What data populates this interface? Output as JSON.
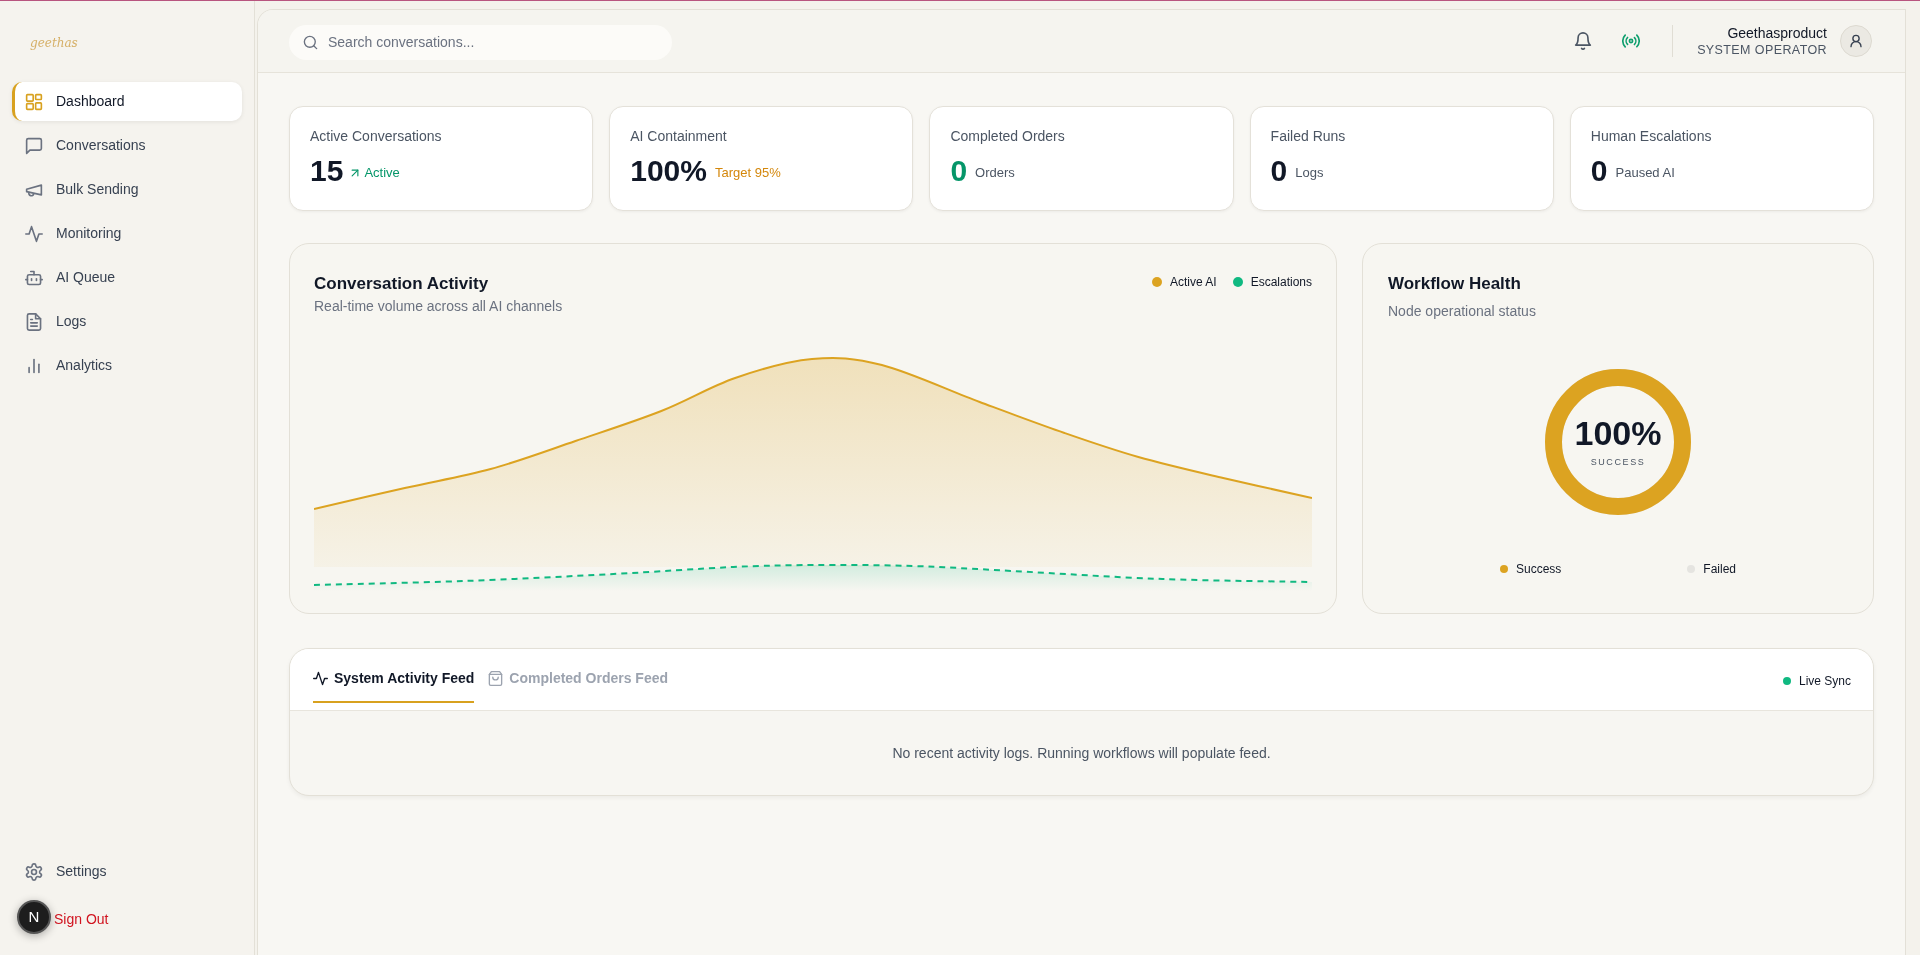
{
  "brand": "geethas",
  "sidebar": {
    "items": [
      {
        "label": "Dashboard",
        "selected": true
      },
      {
        "label": "Conversations",
        "selected": false
      },
      {
        "label": "Bulk Sending",
        "selected": false
      },
      {
        "label": "Monitoring",
        "selected": false
      },
      {
        "label": "AI Queue",
        "selected": false
      },
      {
        "label": "Logs",
        "selected": false
      },
      {
        "label": "Analytics",
        "selected": false
      }
    ],
    "footer": [
      {
        "label": "Settings",
        "kind": "settings"
      },
      {
        "label": "Sign Out",
        "kind": "signout"
      }
    ]
  },
  "dev_badge": "N",
  "header": {
    "search": {
      "placeholder": "Search conversations..."
    },
    "user": {
      "name": "Geethasproduct",
      "role": "SYSTEM OPERATOR"
    }
  },
  "stats": [
    {
      "label": "Active Conversations",
      "value": "15",
      "note": "Active",
      "kind": "trend",
      "highlight": false
    },
    {
      "label": "AI Containment",
      "value": "100%",
      "note": "Target 95%",
      "kind": "target",
      "highlight": false
    },
    {
      "label": "Completed Orders",
      "value": "0",
      "note": "Orders",
      "kind": "unit",
      "highlight": true
    },
    {
      "label": "Failed Runs",
      "value": "0",
      "note": "Logs",
      "kind": "unit",
      "highlight": false
    },
    {
      "label": "Human Escalations",
      "value": "0",
      "note": "Paused AI",
      "kind": "unit",
      "highlight": false
    }
  ],
  "activity_chart": {
    "title": "Conversation Activity",
    "subtitle": "Real-time volume across all AI channels",
    "legend": [
      {
        "label": "Active AI",
        "color": "#dca321"
      },
      {
        "label": "Escalations",
        "color": "#10b981"
      }
    ]
  },
  "health": {
    "title": "Workflow Health",
    "subtitle": "Node operational status",
    "level": 1,
    "value": "100%",
    "caption": "SUCCESS",
    "legend": [
      {
        "label": "Success",
        "color": "#dca321"
      },
      {
        "label": "Failed",
        "color": "#e5e4e0"
      }
    ]
  },
  "feed": {
    "tabs": [
      {
        "label": "System Activity Feed",
        "selected": true
      },
      {
        "label": "Completed Orders Feed",
        "selected": false
      }
    ],
    "status": "Live Sync",
    "empty_message": "No recent activity logs. Running workflows will populate feed."
  }
}
